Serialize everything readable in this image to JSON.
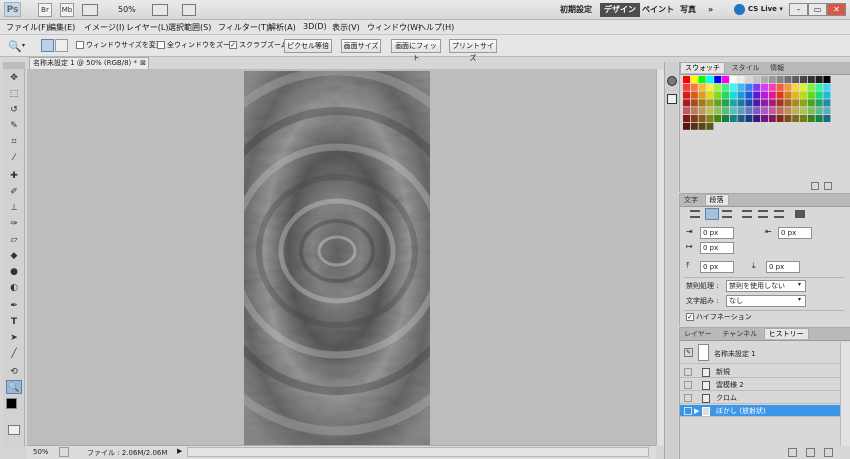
{
  "app": {
    "logo": "Ps",
    "zoom": "50%",
    "buttons": [
      "Br",
      "Mb"
    ]
  },
  "workspaces": [
    "初期設定",
    "デザイン",
    "ペイント",
    "写真",
    "»"
  ],
  "active_workspace": "デザイン",
  "cslive": "CS Live ▾",
  "menu": [
    "ファイル(F)",
    "編集(E)",
    "イメージ(I)",
    "レイヤー(L)",
    "選択範囲(S)",
    "フィルター(T)",
    "解析(A)",
    "3D(D)",
    "表示(V)",
    "ウィンドウ(W)",
    "ヘルプ(H)"
  ],
  "options": {
    "chk1": "ウィンドウサイズを変更",
    "chk2": "全ウィンドウをズーム",
    "chk3": "スクラブズーム",
    "btn1": "ピクセル等倍",
    "btn2": "画面サイズ",
    "btn3": "画面にフィット",
    "btn4": "プリントサイズ"
  },
  "document": {
    "tab": "名称未設定 1 @ 50% (RGB/8) *",
    "zoom": "50%",
    "status": "ファイル : 2.06M/2.06M"
  },
  "swatch_panel": {
    "tabs": [
      "スウォッチ",
      "スタイル",
      "情報"
    ]
  },
  "para_panel": {
    "tabs": [
      "文字",
      "段落"
    ],
    "indent_left": "0 px",
    "indent_right": "0 px",
    "indent_first": "0 px",
    "space_before": "0 px",
    "space_after": "0 px",
    "kinsoku_label": "禁則処理 :",
    "kinsoku_value": "禁則を使用しない",
    "mojikumi_label": "文字組み :",
    "mojikumi_value": "なし",
    "hyphen": "ハイフネーション"
  },
  "history_panel": {
    "tabs": [
      "レイヤー",
      "チャンネル",
      "ヒストリー"
    ],
    "snapshot": "名称未設定 1",
    "items": [
      "新規",
      "雲模様 2",
      "クロム",
      "ぼかし (放射状)"
    ]
  },
  "colors": {
    "accent": "#3399ff",
    "selected_row": "#3c96e8"
  }
}
